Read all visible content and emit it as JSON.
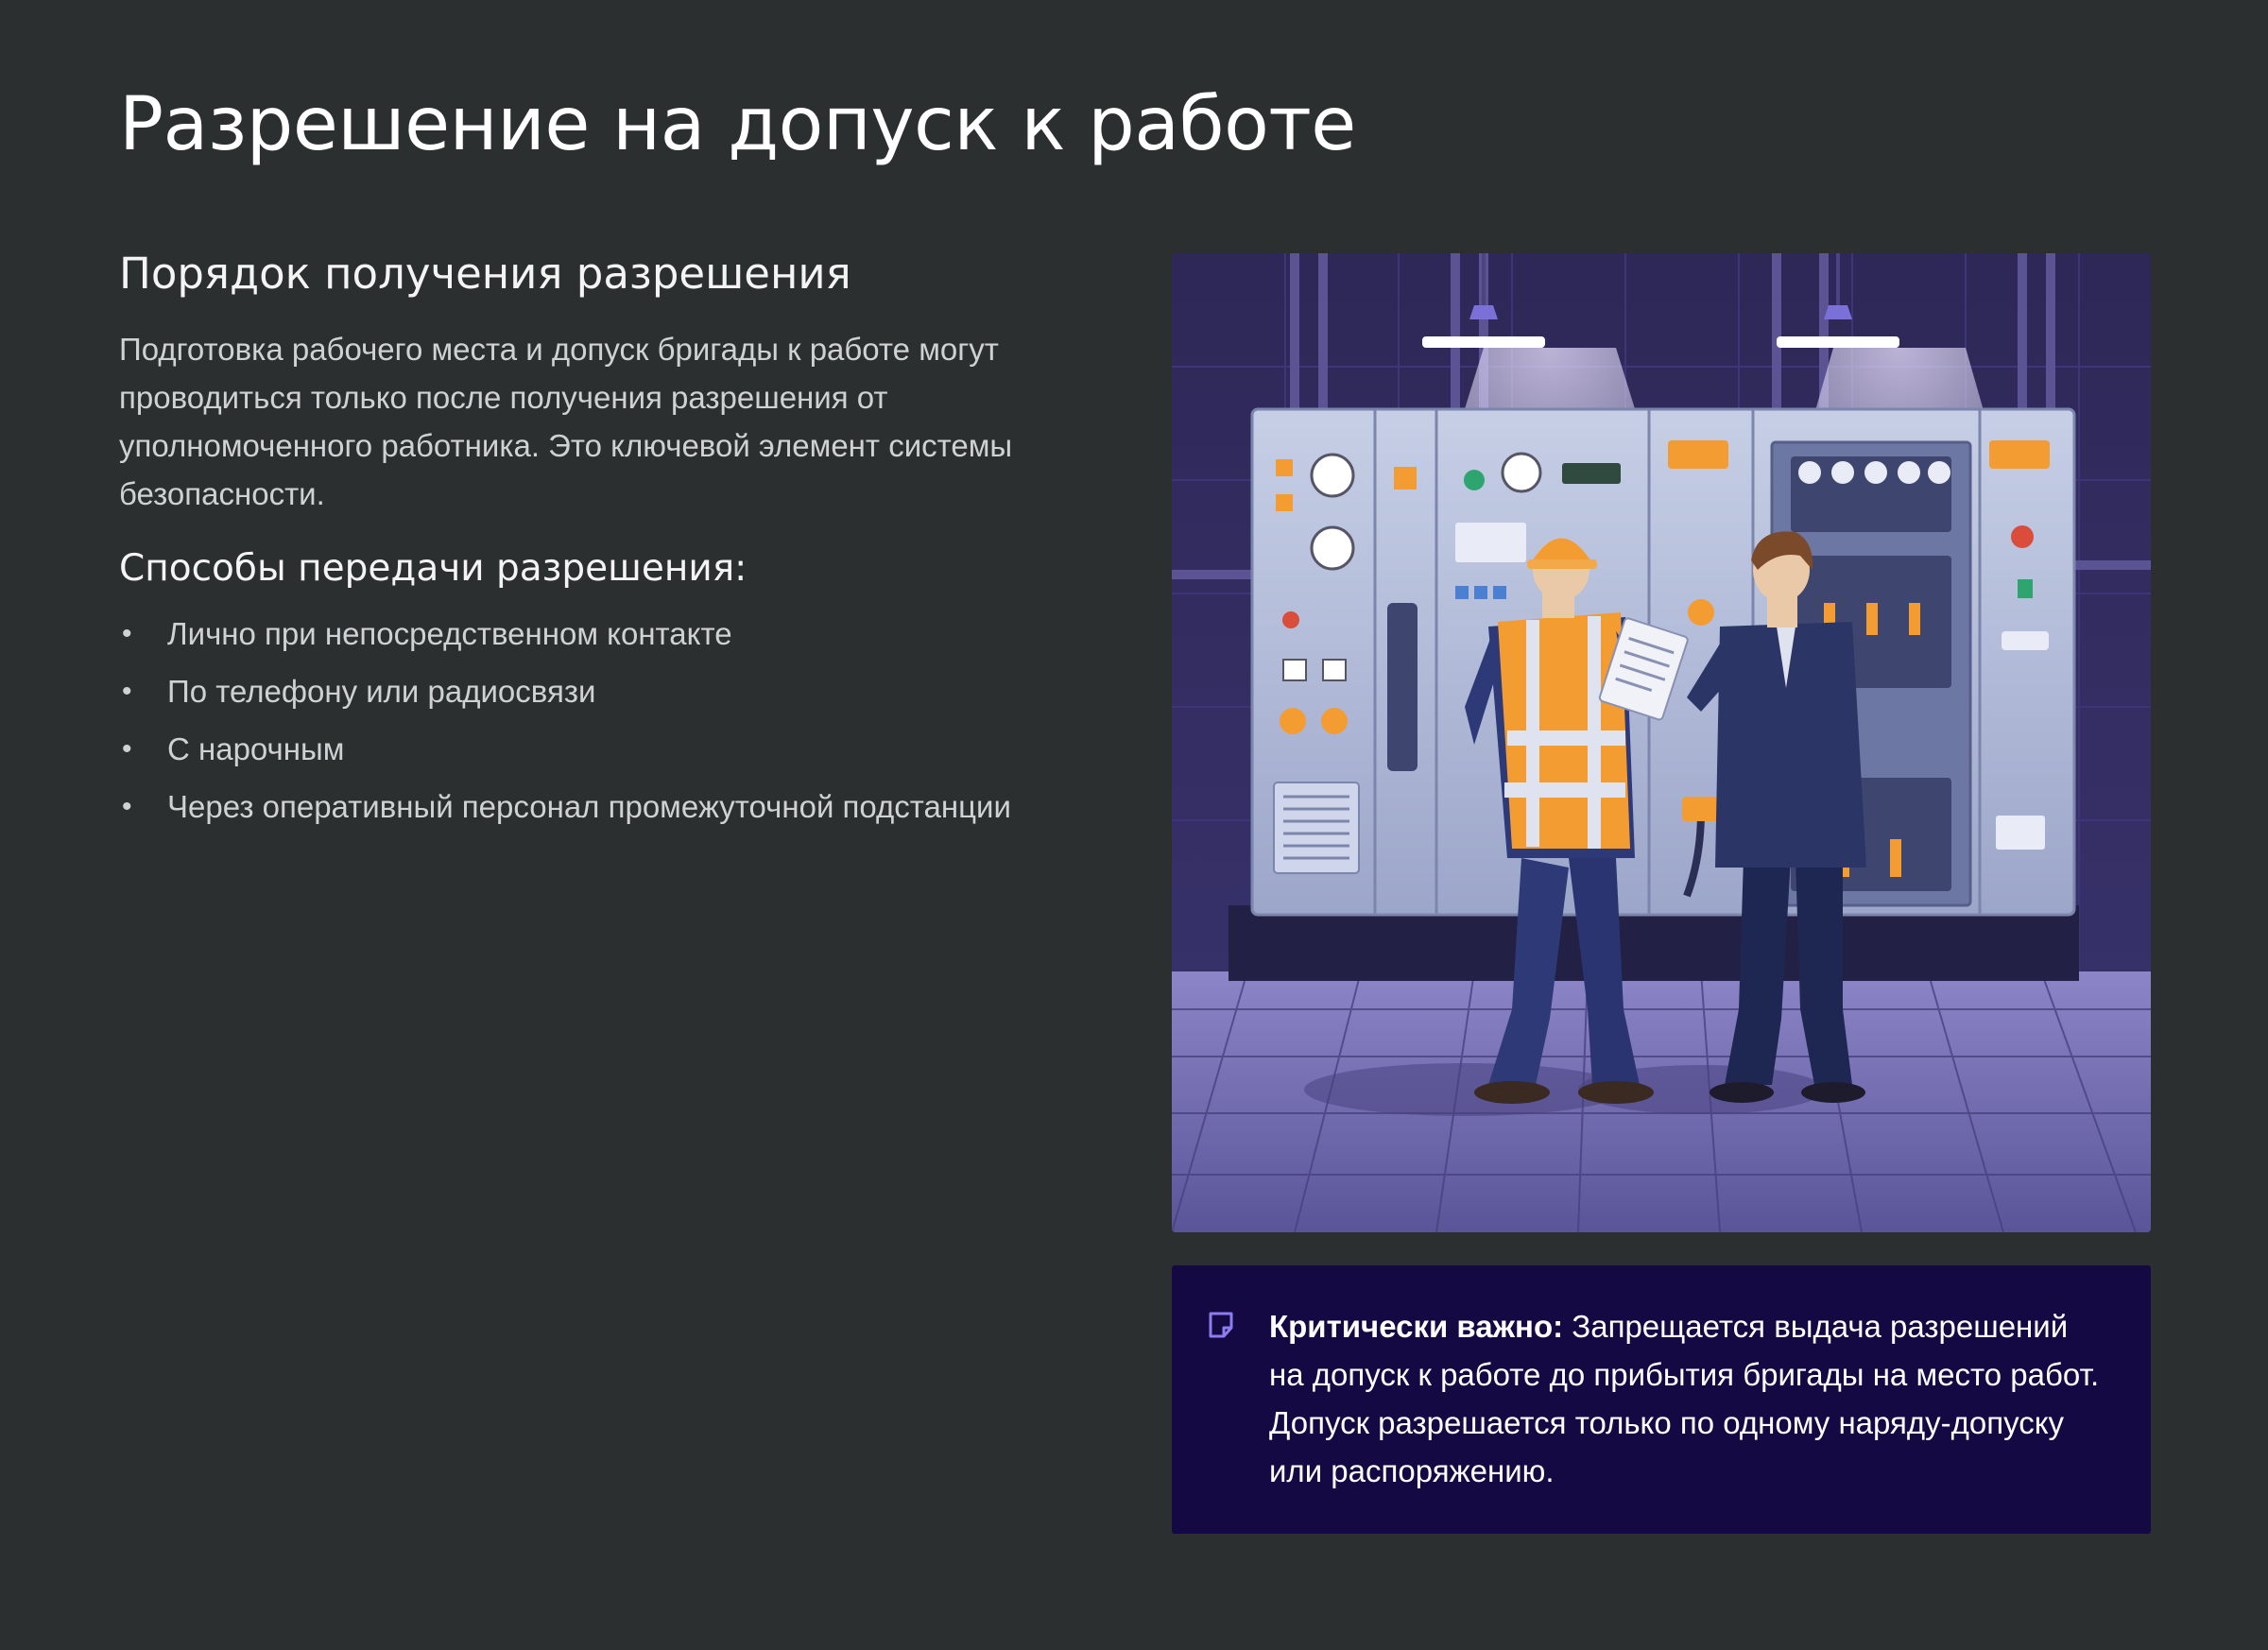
{
  "page": {
    "title": "Разрешение на допуск к работе"
  },
  "left": {
    "section_heading": "Порядок получения разрешения",
    "intro": "Подготовка рабочего места и допуск бригады к работе могут проводиться только после получения разрешения от уполномоченного работника. Это ключевой элемент системы безопасности.",
    "methods_heading": "Способы передачи разрешения:",
    "methods": [
      "Лично при непосредственном контакте",
      "По телефону или радиосвязи",
      "С нарочным",
      "Через оперативный персонал промежуточной подстанции"
    ]
  },
  "illustration": {
    "icon": "illustration-two-workers-at-switchgear-panel"
  },
  "callout": {
    "icon": "sticky-note-icon",
    "label": "Критически важно:",
    "text": "Запрещается выдача разрешений на допуск к работе до прибытия бригады на место работ. Допуск разрешается только по одному наряду-допуску или распоряжению."
  },
  "colors": {
    "background": "#2c2f30",
    "callout_background": "#140942",
    "callout_icon": "#8b7cf0"
  }
}
